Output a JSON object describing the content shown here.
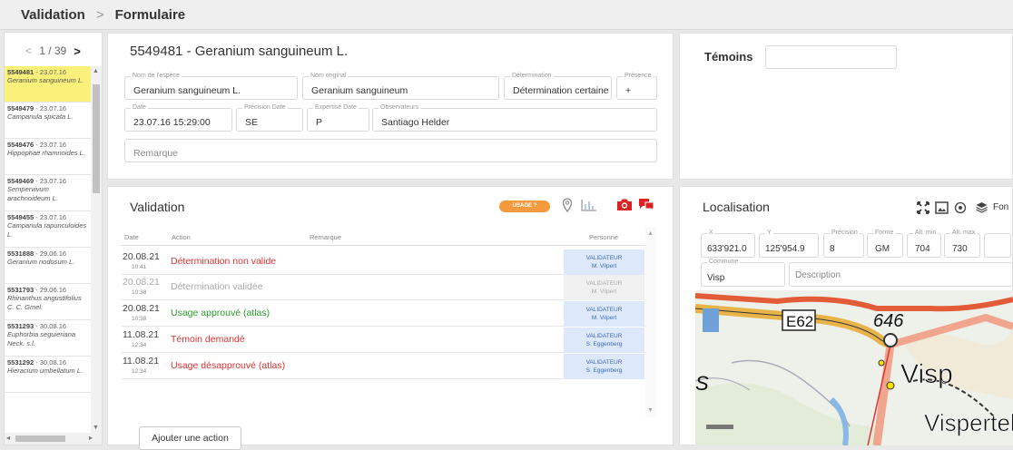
{
  "breadcrumb": {
    "root": "Validation",
    "separator": ">",
    "current": "Formulaire"
  },
  "pager": {
    "prev": "<",
    "position": "1 / 39",
    "next": ">"
  },
  "observations": [
    {
      "id": "5549481",
      "date": "23.07.16",
      "name": "Geranium sanguineum L.",
      "selected": true
    },
    {
      "id": "5549479",
      "date": "23.07.16",
      "name": "Campanula spicata L."
    },
    {
      "id": "5549476",
      "date": "23.07.16",
      "name": "Hippophaë rhamnoides L."
    },
    {
      "id": "5549469",
      "date": "23.07.16",
      "name": "Sempervivum arachnoideum L."
    },
    {
      "id": "5549455",
      "date": "23.07.16",
      "name": "Campanula rapunculoides L."
    },
    {
      "id": "5531888",
      "date": "29.06.16",
      "name": "Geranium nodosum L."
    },
    {
      "id": "5531793",
      "date": "29.06.16",
      "name": "Rhinanthus angustifolius C. C. Gmel."
    },
    {
      "id": "5531293",
      "date": "30.08.16",
      "name": "Euphorbia seguieriana Neck. s.l."
    },
    {
      "id": "5531292",
      "date": "30.08.16",
      "name": "Hieracium umbellatum L."
    }
  ],
  "form": {
    "title": "5549481 - Geranium sanguineum L.",
    "fields": {
      "espece": {
        "label": "Nom de l'espèce",
        "value": "Geranium sanguineum L."
      },
      "original": {
        "label": "Nom original",
        "value": "Geranium sanguineum"
      },
      "determination": {
        "label": "Détermination",
        "value": "Détermination certaine"
      },
      "presence": {
        "label": "Présence",
        "value": "+"
      },
      "date": {
        "label": "Date",
        "value": "23.07.16 15:29:00"
      },
      "precision_date": {
        "label": "Précision Date",
        "value": "SE"
      },
      "expertise_date": {
        "label": "Expertise Date",
        "value": "P"
      },
      "observateurs": {
        "label": "Observateurs",
        "value": "Santiago Helder"
      },
      "remarque": {
        "placeholder": "Remarque"
      }
    }
  },
  "temoins": {
    "title": "Témoins",
    "value": ""
  },
  "validation": {
    "title": "Validation",
    "badge": "USAGE ?",
    "columns": {
      "date": "Date",
      "action": "Action",
      "remarque": "Remarque",
      "personne": "Personne"
    },
    "rows": [
      {
        "date": "20.08.21",
        "time": "10:41",
        "action": "Détermination non valide",
        "role": "VALIDATEUR",
        "person": "M. Vilpert",
        "status": "red"
      },
      {
        "date": "20.08.21",
        "time": "10:38",
        "action": "Détermination validée",
        "role": "VALIDATEUR",
        "person": "M. Vilpert",
        "status": "gray"
      },
      {
        "date": "20.08.21",
        "time": "10:38",
        "action": "Usage approuvé (atlas)",
        "role": "VALIDATEUR",
        "person": "M. Vilpert",
        "status": "green"
      },
      {
        "date": "11.08.21",
        "time": "12:34",
        "action": "Témoin demandé",
        "role": "VALIDATEUR",
        "person": "S. Eggenberg",
        "status": "red"
      },
      {
        "date": "11.08.21",
        "time": "12:34",
        "action": "Usage désapprouvé (atlas)",
        "role": "VALIDATEUR",
        "person": "S. Eggenberg",
        "status": "red"
      }
    ],
    "add_action": "Ajouter une action"
  },
  "localisation": {
    "title": "Localisation",
    "fond_label": "Fon",
    "fields": {
      "x": {
        "label": "X",
        "value": "633'921.0"
      },
      "y": {
        "label": "Y",
        "value": "125'954.9"
      },
      "precision": {
        "label": "Précision",
        "value": "8"
      },
      "forme": {
        "label": "Forme",
        "value": "GM"
      },
      "alt_min": {
        "label": "Alt. min",
        "value": "704"
      },
      "alt_max": {
        "label": "Alt. max",
        "value": "730"
      },
      "commune": {
        "label": "Commune",
        "value": "Visp"
      },
      "description": {
        "placeholder": "Description"
      }
    },
    "map": {
      "label_road": "E62",
      "label_alt": "646",
      "label_town": "Visp",
      "label_town2": "Vispertel",
      "label_s": "S"
    }
  },
  "colors": {
    "accent": "#f39a3e",
    "red": "#dd3333",
    "green": "#2a9a2a",
    "selected": "#fbf07a",
    "person_bg": "#dde9fb"
  }
}
